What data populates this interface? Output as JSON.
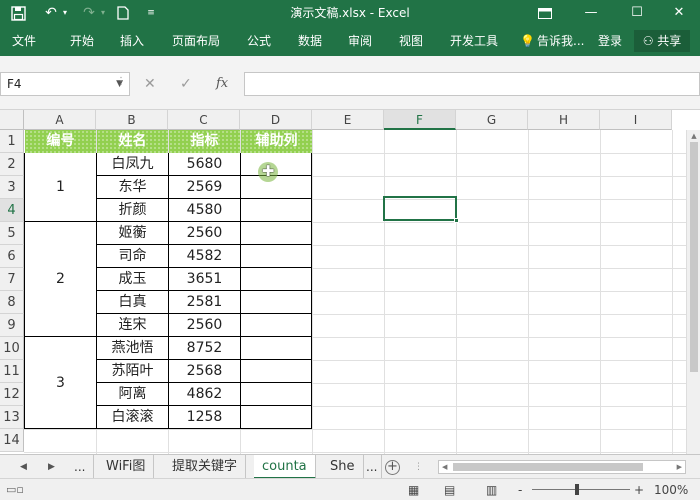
{
  "titlebar": {
    "title": "演示文稿.xlsx - Excel",
    "icons": [
      "save-icon",
      "undo-icon",
      "redo-icon",
      "new-file-icon",
      "customize-qat-icon",
      "ribbon-display-icon",
      "minimize-icon",
      "maximize-icon",
      "close-icon"
    ]
  },
  "ribbon": {
    "tabs": [
      "文件",
      "开始",
      "插入",
      "页面布局",
      "公式",
      "数据",
      "审阅",
      "视图",
      "开发工具"
    ],
    "tell_me": "告诉我...",
    "login": "登录",
    "share": "共享"
  },
  "formula_bar": {
    "name_box": "F4",
    "content": ""
  },
  "grid": {
    "columns": [
      "A",
      "B",
      "C",
      "D",
      "E",
      "F",
      "G",
      "H",
      "I"
    ],
    "active_column": "F",
    "rows": [
      "1",
      "2",
      "3",
      "4",
      "5",
      "6",
      "7",
      "8",
      "9",
      "10",
      "11",
      "12",
      "13",
      "14"
    ],
    "active_row": "4",
    "selected_cell": "F4",
    "header": [
      "编号",
      "姓名",
      "指标",
      "辅助列"
    ],
    "groups": [
      {
        "id": "1",
        "names": [
          "白凤九",
          "东华",
          "折颜"
        ],
        "values": [
          "5680",
          "2569",
          "4580"
        ]
      },
      {
        "id": "2",
        "names": [
          "姬蘅",
          "司命",
          "成玉",
          "白真",
          "连宋"
        ],
        "values": [
          "2560",
          "4582",
          "3651",
          "2581",
          "2560"
        ]
      },
      {
        "id": "3",
        "names": [
          "燕池悟",
          "苏陌叶",
          "阿离",
          "白滚滚"
        ],
        "values": [
          "8752",
          "2568",
          "4862",
          "1258"
        ]
      }
    ],
    "header_color": "#92d050"
  },
  "sheets": {
    "ellipsis": "...",
    "tabs": [
      "WiFi图",
      "提取关键字",
      "counta",
      "She"
    ],
    "active": "counta"
  },
  "status": {
    "zoom": "100%",
    "zoom_minus": "-",
    "zoom_plus": "+"
  },
  "colors": {
    "accent": "#217346"
  }
}
